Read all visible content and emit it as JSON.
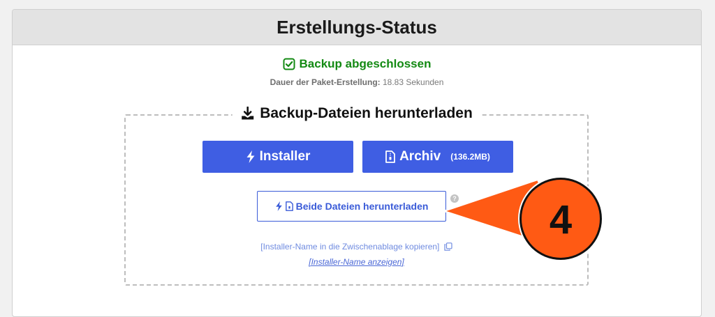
{
  "panel": {
    "title": "Erstellungs-Status"
  },
  "status": {
    "icon": "checkbox-check-icon",
    "text": "Backup abgeschlossen",
    "color": "#138a13"
  },
  "duration": {
    "label": "Dauer der Paket-Erstellung:",
    "value": "18.83 Sekunden"
  },
  "downloads": {
    "legend_icon": "download-icon",
    "legend": "Backup-Dateien herunterladen",
    "installer_button": {
      "icon": "bolt-icon",
      "label": "Installer"
    },
    "archive_button": {
      "icon": "zip-file-icon",
      "label": "Archiv",
      "size": "(136.2MB)"
    },
    "both_button": {
      "label": "Beide Dateien herunterladen"
    },
    "help_icon": "?",
    "copy_link": "[Installer-Name in die Zwischenablage kopieren]",
    "show_link": "[Installer-Name anzeigen]"
  },
  "callout": {
    "number": "4",
    "color": "#ff5a14"
  },
  "colors": {
    "primary": "#3f5ee3",
    "header_bg": "#e3e3e3",
    "page_bg": "#f1f1f1"
  }
}
